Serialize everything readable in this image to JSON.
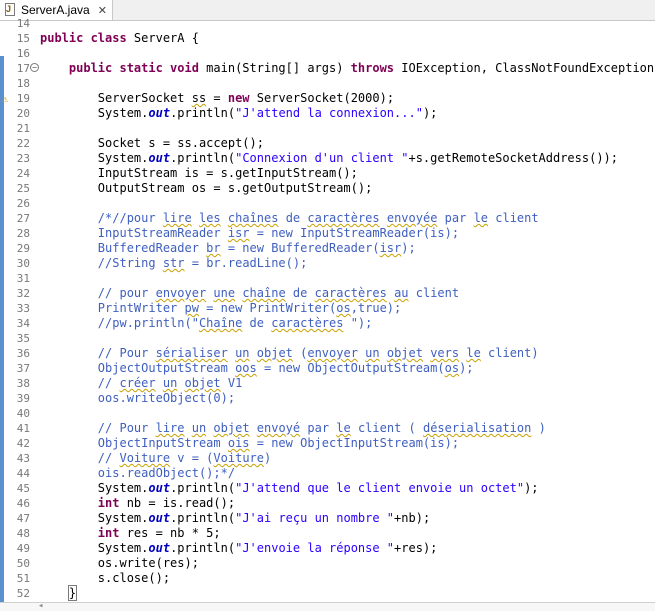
{
  "tab": {
    "title": "ServerA.java",
    "close": "✕",
    "icon": "java-file-icon"
  },
  "lines": [
    {
      "n": "14",
      "html": ""
    },
    {
      "n": "15",
      "html": "<span class='kw'>public class</span> ServerA {"
    },
    {
      "n": "16",
      "html": ""
    },
    {
      "n": "17",
      "fold": true,
      "html": "    <span class='kw'>public static void</span> main(String[] args) <span class='kw'>throws</span> IOException, ClassNotFoundException <span class='brace-box'>{</span>"
    },
    {
      "n": "18",
      "html": ""
    },
    {
      "n": "19",
      "warn": true,
      "html": "        ServerSocket <span class='sq'>ss</span> = <span class='kw'>new</span> ServerSocket(2000);"
    },
    {
      "n": "20",
      "html": "        System.<span class='fld'>out</span>.println(<span class='str'>\"J'attend la connexion...\"</span>);"
    },
    {
      "n": "21",
      "html": ""
    },
    {
      "n": "22",
      "html": "        Socket s = ss.accept();"
    },
    {
      "n": "23",
      "html": "        System.<span class='fld'>out</span>.println(<span class='str'>\"Connexion d'un client \"</span>+s.getRemoteSocketAddress());"
    },
    {
      "n": "24",
      "html": "        InputStream is = s.getInputStream();"
    },
    {
      "n": "25",
      "html": "        OutputStream os = s.getOutputStream();"
    },
    {
      "n": "26",
      "html": ""
    },
    {
      "n": "27",
      "html": "        <span class='cm'>/*//pour <span class='sq'>lire</span> <span class='sq'>les</span> <span class='sq'>chaînes</span> de <span class='sq'>caractères</span> <span class='sq'>envoyée</span> par <span class='sq'>le</span> client</span>"
    },
    {
      "n": "28",
      "html": "        <span class='cm'>InputStreamReader <span class='sq'>isr</span> = new InputStreamReader(is);</span>"
    },
    {
      "n": "29",
      "html": "        <span class='cm'>BufferedReader <span class='sq'>br</span> = new BufferedReader(<span class='sq'>isr</span>);</span>"
    },
    {
      "n": "30",
      "html": "        <span class='cm'>//String <span class='sq'>str</span> = br.readLine();</span>"
    },
    {
      "n": "31",
      "html": ""
    },
    {
      "n": "32",
      "html": "        <span class='cm'>// pour <span class='sq'>envoyer</span> <span class='sq'>une</span> <span class='sq'>chaîne</span> de <span class='sq'>caractères</span> <span class='sq'>au</span> client</span>"
    },
    {
      "n": "33",
      "html": "        <span class='cm'>PrintWriter <span class='sq'>pw</span> = new PrintWriter(<span class='sq'>os</span>,true);</span>"
    },
    {
      "n": "34",
      "html": "        <span class='cm'>//pw.println(\"<span class='sq'>Chaîne</span> de <span class='sq'>caractères</span> \");</span>"
    },
    {
      "n": "35",
      "html": ""
    },
    {
      "n": "36",
      "html": "        <span class='cm'>// Pour <span class='sq'>sérialiser</span> <span class='sq'>un</span> <span class='sq'>objet</span> (<span class='sq'>envoyer</span> <span class='sq'>un</span> <span class='sq'>objet</span> <span class='sq'>vers</span> <span class='sq'>le</span> client)</span>"
    },
    {
      "n": "37",
      "html": "        <span class='cm'>ObjectOutputStream <span class='sq'>oos</span> = new ObjectOutputStream(<span class='sq'>os</span>);</span>"
    },
    {
      "n": "38",
      "html": "        <span class='cm'>// <span class='sq'>créer</span> <span class='sq'>un</span> <span class='sq'>objet</span> V1</span>"
    },
    {
      "n": "39",
      "html": "        <span class='cm'>oos.writeObject(0);</span>"
    },
    {
      "n": "40",
      "html": ""
    },
    {
      "n": "41",
      "html": "        <span class='cm'>// Pour <span class='sq'>lire</span> <span class='sq'>un</span> <span class='sq'>objet</span> <span class='sq'>envoyé</span> par <span class='sq'>le</span> client ( <span class='sq'>déserialisation</span> )</span>"
    },
    {
      "n": "42",
      "html": "        <span class='cm'>ObjectInputStream <span class='sq'>ois</span> = new ObjectInputStream(is);</span>"
    },
    {
      "n": "43",
      "html": "        <span class='cm'>// <span class='sq'>Voiture</span> v = (<span class='sq'>Voiture</span>)</span>"
    },
    {
      "n": "44",
      "html": "        <span class='cm'>ois.readObject();*/</span>"
    },
    {
      "n": "45",
      "html": "        System.<span class='fld'>out</span>.println(<span class='str'>\"J'attend que le client envoie un octet\"</span>);"
    },
    {
      "n": "46",
      "html": "        <span class='kw'>int</span> nb = is.read();"
    },
    {
      "n": "47",
      "html": "        System.<span class='fld'>out</span>.println(<span class='str'>\"J'ai reçu un nombre \"</span>+nb);"
    },
    {
      "n": "48",
      "html": "        <span class='kw'>int</span> res = nb * 5;"
    },
    {
      "n": "49",
      "html": "        System.<span class='fld'>out</span>.println(<span class='str'>\"J'envoie la réponse \"</span>+res);"
    },
    {
      "n": "50",
      "html": "        os.write(res);"
    },
    {
      "n": "51",
      "html": "        s.close();"
    },
    {
      "n": "52",
      "caret": true,
      "html": "    <span class='brace-box'>}</span>"
    }
  ]
}
